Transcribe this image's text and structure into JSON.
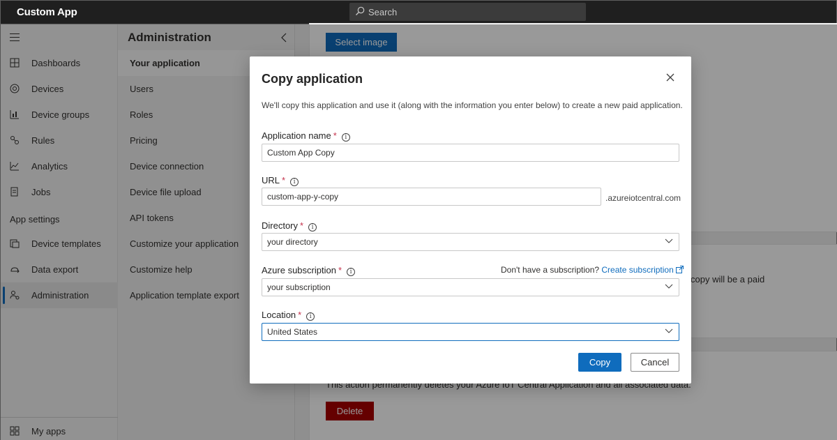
{
  "app": {
    "title": "Custom App"
  },
  "search": {
    "placeholder": "Search"
  },
  "leftnav": {
    "items": [
      {
        "label": "Dashboards",
        "icon": "dashboard-icon"
      },
      {
        "label": "Devices",
        "icon": "devices-icon"
      },
      {
        "label": "Device groups",
        "icon": "device-groups-icon"
      },
      {
        "label": "Rules",
        "icon": "rules-icon"
      },
      {
        "label": "Analytics",
        "icon": "analytics-icon"
      },
      {
        "label": "Jobs",
        "icon": "jobs-icon"
      }
    ],
    "section_label": "App settings",
    "settings_items": [
      {
        "label": "Device templates",
        "icon": "device-templates-icon"
      },
      {
        "label": "Data export",
        "icon": "data-export-icon"
      },
      {
        "label": "Administration",
        "icon": "administration-icon",
        "active": true
      }
    ],
    "bottom_item": {
      "label": "My apps",
      "icon": "my-apps-icon"
    }
  },
  "admin": {
    "title": "Administration",
    "items": [
      {
        "label": "Your application",
        "active": true
      },
      {
        "label": "Users"
      },
      {
        "label": "Roles"
      },
      {
        "label": "Pricing"
      },
      {
        "label": "Device connection"
      },
      {
        "label": "Device file upload"
      },
      {
        "label": "API tokens"
      },
      {
        "label": "Customize your application"
      },
      {
        "label": "Customize help"
      },
      {
        "label": "Application template export"
      }
    ]
  },
  "background": {
    "select_image_label": "Select image",
    "copy_text_fragment": "copy will be a paid",
    "delete_text": "This action permanently deletes your Azure IoT Central Application and all associated data.",
    "delete_label": "Delete"
  },
  "dialog": {
    "title": "Copy application",
    "description": "We'll copy this application and use it (along with the information you enter below) to create a new paid application.",
    "app_name": {
      "label": "Application name",
      "required_mark": "*",
      "value": "Custom App Copy"
    },
    "url": {
      "label": "URL",
      "required_mark": "*",
      "value": "custom-app-y-copy",
      "suffix": ".azureiotcentral.com"
    },
    "directory": {
      "label": "Directory",
      "required_mark": "*",
      "value": "your directory"
    },
    "subscription": {
      "label": "Azure subscription",
      "required_mark": "*",
      "value": "your subscription",
      "help_text": "Don't have a subscription?",
      "help_link": "Create subscription"
    },
    "location": {
      "label": "Location",
      "required_mark": "*",
      "value": "United States"
    },
    "copy_label": "Copy",
    "cancel_label": "Cancel"
  },
  "colors": {
    "accent": "#0f6cbd",
    "danger": "#a80000",
    "required": "#c4314b",
    "topbar": "#1f1f1f"
  }
}
